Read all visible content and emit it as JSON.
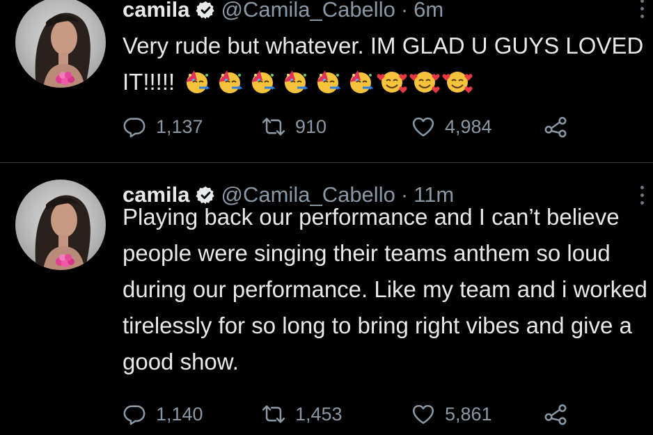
{
  "tweets": [
    {
      "name": "camila",
      "handle": "@Camila_Cabello",
      "separator": "·",
      "time": "6m",
      "text": "Very rude but whatever. IM GLAD U GUYS LOVED IT!!!!!",
      "emojis": [
        "partying-face",
        "partying-face",
        "partying-face",
        "partying-face",
        "partying-face",
        "partying-face",
        "smiling-face-with-hearts",
        "smiling-face-with-hearts",
        "smiling-face-with-hearts"
      ],
      "replies": "1,137",
      "retweets": "910",
      "likes": "4,984"
    },
    {
      "name": "camila",
      "handle": "@Camila_Cabello",
      "separator": "·",
      "time": "11m",
      "text": "Playing back our performance and I can’t believe people were singing their teams anthem so loud during our performance. Like my team and i worked tirelessly for so long to bring right vibes and give a good show.",
      "replies": "1,140",
      "retweets": "1,453",
      "likes": "5,861"
    }
  ],
  "icons": {
    "verified": "verified-badge-icon",
    "more": "more-options-icon",
    "reply": "reply-icon",
    "retweet": "retweet-icon",
    "like": "heart-icon",
    "share": "share-icon"
  },
  "colors": {
    "background": "#000000",
    "text": "#e7e9ea",
    "secondary": "#8b98a5",
    "divider": "#2f3336"
  }
}
